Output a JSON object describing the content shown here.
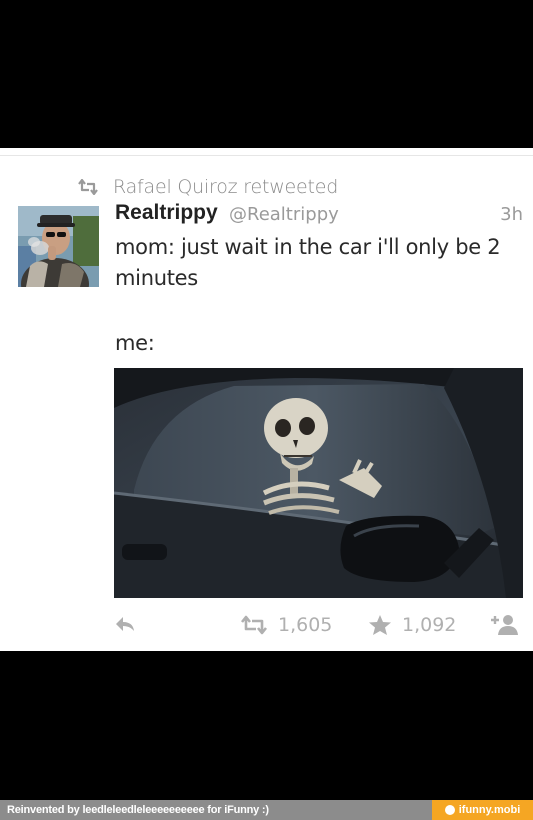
{
  "retweet_banner": {
    "icon": "retweet-icon",
    "text": "Rafael Quiroz  retweeted"
  },
  "tweet": {
    "avatar_icon": "user-avatar",
    "display_name": "Realtrippy",
    "handle": "@Realtrippy",
    "time": "3h",
    "text_line1": "mom: just wait in the car i'll only be 2 minutes",
    "text_line2": "me:",
    "media_description_icon": "skeleton-in-car-photo"
  },
  "actions": {
    "reply_icon": "reply-icon",
    "retweet_icon": "retweet-icon",
    "retweet_count": "1,605",
    "favorite_icon": "star-icon",
    "favorite_count": "1,092",
    "follow_icon": "follow-user-icon"
  },
  "footer": {
    "credit": "Reinvented by leedleleedleleeeeeeeeee for iFunny :)",
    "brand": "ifunny.mobi"
  },
  "colors": {
    "card_bg": "#ffffff",
    "meta_gray": "#9a9a9a",
    "action_gray": "#b0b0b0",
    "footer_gray": "#8c8c8c",
    "brand_orange": "#f5a623"
  }
}
